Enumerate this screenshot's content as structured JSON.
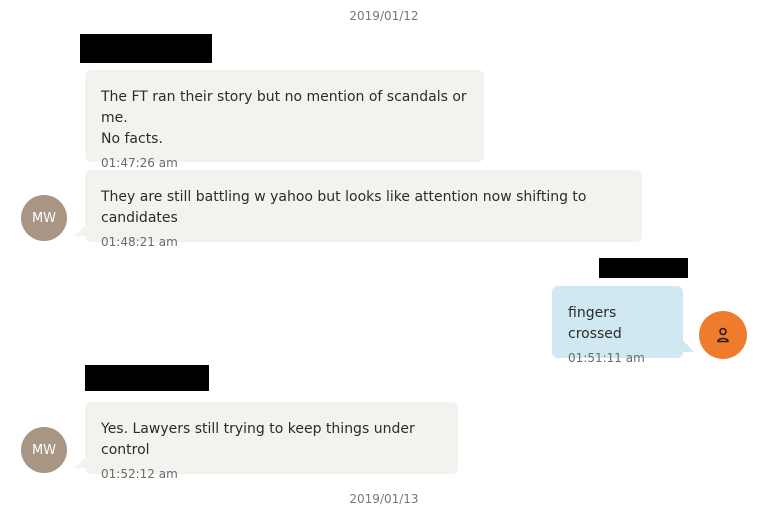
{
  "conversation": {
    "date_start": "2019/01/12",
    "date_end": "2019/01/13",
    "messages": [
      {
        "text": "The FT ran their story but no mention of scandals or me.\nNo facts.",
        "time": "01:47:26 am"
      },
      {
        "text": "They are still battling w yahoo but looks like attention now shifting to candidates",
        "time": "01:48:21 am",
        "avatar_initials": "MW"
      },
      {
        "text": "fingers crossed",
        "time": "01:51:11 am",
        "avatar_icon": "person-icon"
      },
      {
        "text": "Yes. Lawyers still trying to keep things under control",
        "time": "01:52:12 am",
        "avatar_initials": "MW"
      }
    ]
  },
  "colors": {
    "incoming_bubble": "#f3f2ef",
    "outgoing_bubble": "#cfe8f1",
    "contact_avatar": "#a89584",
    "user_avatar": "#ef7c2c",
    "redaction": "#000000"
  }
}
